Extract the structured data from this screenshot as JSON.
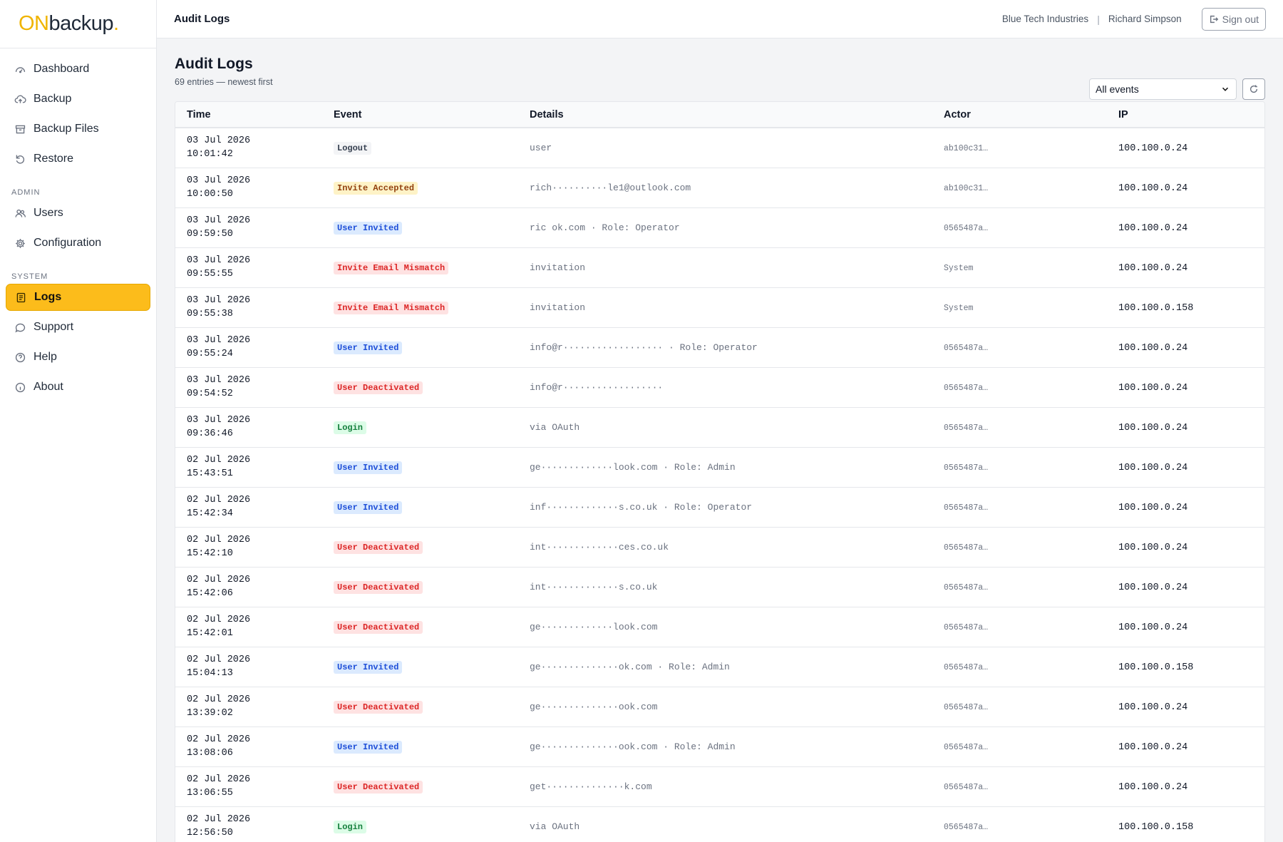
{
  "brand": {
    "on": "ON",
    "rest": "backup",
    "dot": "."
  },
  "sidebar": {
    "items_top": [
      {
        "label": "Dashboard",
        "icon": "gauge-icon"
      },
      {
        "label": "Backup",
        "icon": "cloud-upload-icon"
      },
      {
        "label": "Backup Files",
        "icon": "archive-icon"
      },
      {
        "label": "Restore",
        "icon": "restore-icon"
      }
    ],
    "admin_label": "ADMIN",
    "items_admin": [
      {
        "label": "Users",
        "icon": "users-icon"
      },
      {
        "label": "Configuration",
        "icon": "gear-icon"
      }
    ],
    "system_label": "SYSTEM",
    "items_system": [
      {
        "label": "Logs",
        "icon": "logs-icon",
        "active": true
      },
      {
        "label": "Support",
        "icon": "chat-icon"
      },
      {
        "label": "Help",
        "icon": "help-icon"
      },
      {
        "label": "About",
        "icon": "info-icon"
      }
    ]
  },
  "topbar": {
    "title": "Audit Logs",
    "org": "Blue Tech Industries",
    "separator": "|",
    "user": "Richard Simpson",
    "signout": "Sign out"
  },
  "page": {
    "title": "Audit Logs",
    "subtitle": "69 entries — newest first",
    "filter_value": "All events"
  },
  "colors": {
    "accent": "#fcbc1b",
    "brand_on": "#f0b400"
  },
  "table": {
    "headers": [
      "Time",
      "Event",
      "Details",
      "Actor",
      "IP"
    ],
    "rows": [
      {
        "date": "03 Jul 2026",
        "time": "10:01:42",
        "event": "Logout",
        "kind": "gray",
        "details": "user",
        "actor": "ab100c31…",
        "ip": "100.100.0.24"
      },
      {
        "date": "03 Jul 2026",
        "time": "10:00:50",
        "event": "Invite Accepted",
        "kind": "amber",
        "details": "rich··········le1@outlook.com",
        "actor": "ab100c31…",
        "ip": "100.100.0.24"
      },
      {
        "date": "03 Jul 2026",
        "time": "09:59:50",
        "event": "User Invited",
        "kind": "blue",
        "details": "ric                         ok.com · Role: Operator",
        "actor": "0565487a…",
        "ip": "100.100.0.24"
      },
      {
        "date": "03 Jul 2026",
        "time": "09:55:55",
        "event": "Invite Email Mismatch",
        "kind": "red",
        "details": "invitation",
        "actor": "System",
        "ip": "100.100.0.24"
      },
      {
        "date": "03 Jul 2026",
        "time": "09:55:38",
        "event": "Invite Email Mismatch",
        "kind": "red",
        "details": "invitation",
        "actor": "System",
        "ip": "100.100.0.158"
      },
      {
        "date": "03 Jul 2026",
        "time": "09:55:24",
        "event": "User Invited",
        "kind": "blue",
        "details": "info@r·················· · Role: Operator",
        "actor": "0565487a…",
        "ip": "100.100.0.24"
      },
      {
        "date": "03 Jul 2026",
        "time": "09:54:52",
        "event": "User Deactivated",
        "kind": "red",
        "details": "info@r··················",
        "actor": "0565487a…",
        "ip": "100.100.0.24"
      },
      {
        "date": "03 Jul 2026",
        "time": "09:36:46",
        "event": "Login",
        "kind": "green",
        "details": "via OAuth",
        "actor": "0565487a…",
        "ip": "100.100.0.24"
      },
      {
        "date": "02 Jul 2026",
        "time": "15:43:51",
        "event": "User Invited",
        "kind": "blue",
        "details": "ge·············look.com · Role: Admin",
        "actor": "0565487a…",
        "ip": "100.100.0.24"
      },
      {
        "date": "02 Jul 2026",
        "time": "15:42:34",
        "event": "User Invited",
        "kind": "blue",
        "details": "inf·············s.co.uk · Role: Operator",
        "actor": "0565487a…",
        "ip": "100.100.0.24"
      },
      {
        "date": "02 Jul 2026",
        "time": "15:42:10",
        "event": "User Deactivated",
        "kind": "red",
        "details": "int·············ces.co.uk",
        "actor": "0565487a…",
        "ip": "100.100.0.24"
      },
      {
        "date": "02 Jul 2026",
        "time": "15:42:06",
        "event": "User Deactivated",
        "kind": "red",
        "details": "int·············s.co.uk",
        "actor": "0565487a…",
        "ip": "100.100.0.24"
      },
      {
        "date": "02 Jul 2026",
        "time": "15:42:01",
        "event": "User Deactivated",
        "kind": "red",
        "details": "ge·············look.com",
        "actor": "0565487a…",
        "ip": "100.100.0.24"
      },
      {
        "date": "02 Jul 2026",
        "time": "15:04:13",
        "event": "User Invited",
        "kind": "blue",
        "details": "ge··············ok.com · Role: Admin",
        "actor": "0565487a…",
        "ip": "100.100.0.158"
      },
      {
        "date": "02 Jul 2026",
        "time": "13:39:02",
        "event": "User Deactivated",
        "kind": "red",
        "details": "ge··············ook.com",
        "actor": "0565487a…",
        "ip": "100.100.0.24"
      },
      {
        "date": "02 Jul 2026",
        "time": "13:08:06",
        "event": "User Invited",
        "kind": "blue",
        "details": "ge··············ook.com · Role: Admin",
        "actor": "0565487a…",
        "ip": "100.100.0.24"
      },
      {
        "date": "02 Jul 2026",
        "time": "13:06:55",
        "event": "User Deactivated",
        "kind": "red",
        "details": "get··············k.com",
        "actor": "0565487a…",
        "ip": "100.100.0.24"
      },
      {
        "date": "02 Jul 2026",
        "time": "12:56:50",
        "event": "Login",
        "kind": "green",
        "details": "via OAuth",
        "actor": "0565487a…",
        "ip": "100.100.0.158"
      }
    ]
  }
}
